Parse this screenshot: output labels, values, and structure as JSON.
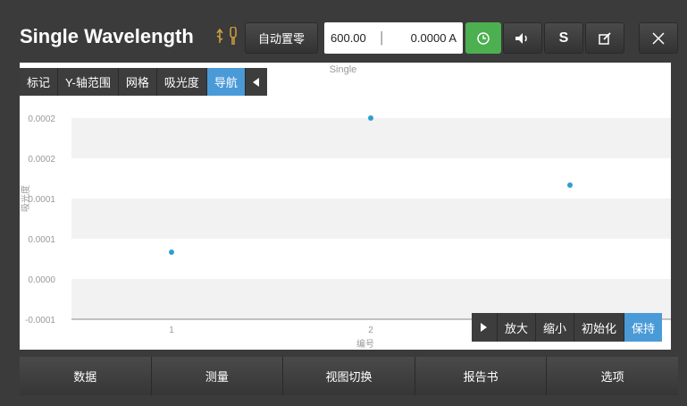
{
  "header": {
    "title": "Single Wavelength",
    "usb_icon": "usb-icon",
    "auto_zero_label": "自动置零",
    "wavelength_value": "600.00",
    "reading_value": "0.0000 A",
    "timer_icon": "clock-icon",
    "sound_icon": "speaker-icon",
    "s_label": "S",
    "edit_icon": "edit-icon",
    "close_icon": "close-icon"
  },
  "nav_toolbar": {
    "items": [
      {
        "label": "标记",
        "active": false
      },
      {
        "label": "Y-轴范围",
        "active": false
      },
      {
        "label": "网格",
        "active": false
      },
      {
        "label": "吸光度",
        "active": false
      },
      {
        "label": "导航",
        "active": true
      }
    ],
    "collapse_icon": "triangle-left-icon"
  },
  "zoom_toolbar": {
    "expand_icon": "triangle-right-icon",
    "items": [
      {
        "label": "放大",
        "active": false
      },
      {
        "label": "缩小",
        "active": false
      },
      {
        "label": "初始化",
        "active": false
      },
      {
        "label": "保持",
        "active": true
      }
    ]
  },
  "bottom_tabs": [
    "数据",
    "测量",
    "视图切换",
    "报告书",
    "选项"
  ],
  "chart_data": {
    "type": "scatter",
    "title": "Single",
    "xlabel": "编号",
    "ylabel": "吸光度",
    "x_ticks": [
      "1",
      "2"
    ],
    "y_ticks": [
      "0.0002",
      "0.0002",
      "0.0001",
      "0.0001",
      "0.0000",
      "-0.0001"
    ],
    "series": [
      {
        "x": [
          1,
          2,
          3
        ],
        "y": [
          0.0,
          0.0002,
          0.0001
        ],
        "color": "#2e9fd4"
      }
    ]
  }
}
